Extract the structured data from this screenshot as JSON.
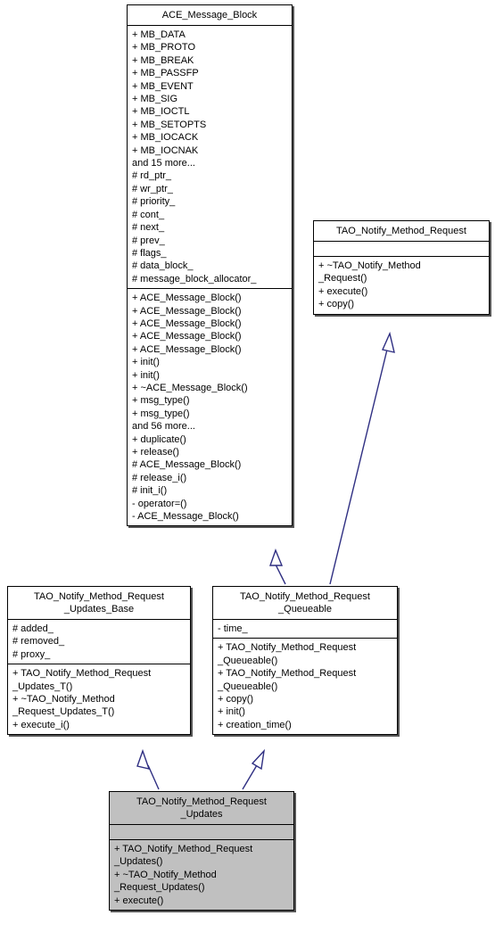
{
  "diagram": {
    "type": "uml-class-diagram",
    "background_color": "#ffffff",
    "edge_color": "#2f2f82",
    "shaded_fill": "#c0c0c0",
    "classes": [
      {
        "id": "ace_message_block",
        "name": "ACE_Message_Block",
        "shaded": false,
        "attributes": [
          "+ MB_DATA",
          "+ MB_PROTO",
          "+ MB_BREAK",
          "+ MB_PASSFP",
          "+ MB_EVENT",
          "+ MB_SIG",
          "+ MB_IOCTL",
          "+ MB_SETOPTS",
          "+ MB_IOCACK",
          "+ MB_IOCNAK",
          "and 15 more...",
          "# rd_ptr_",
          "# wr_ptr_",
          "# priority_",
          "# cont_",
          "# next_",
          "# prev_",
          "# flags_",
          "# data_block_",
          "# message_block_allocator_"
        ],
        "operations": [
          "+ ACE_Message_Block()",
          "+ ACE_Message_Block()",
          "+ ACE_Message_Block()",
          "+ ACE_Message_Block()",
          "+ ACE_Message_Block()",
          "+ init()",
          "+ init()",
          "+ ~ACE_Message_Block()",
          "+ msg_type()",
          "+ msg_type()",
          "and 56 more...",
          "+ duplicate()",
          "+ release()",
          "# ACE_Message_Block()",
          "# release_i()",
          "# init_i()",
          "- operator=()",
          "- ACE_Message_Block()"
        ]
      },
      {
        "id": "tao_notify_method_request",
        "name": "TAO_Notify_Method_Request",
        "shaded": false,
        "attributes": [],
        "operations": [
          "+ ~TAO_Notify_Method\n_Request()",
          "+ execute()",
          "+ copy()"
        ]
      },
      {
        "id": "tao_notify_method_request_updates_base",
        "name": "TAO_Notify_Method_Request\n_Updates_Base",
        "shaded": false,
        "attributes": [
          "# added_",
          "# removed_",
          "# proxy_"
        ],
        "operations": [
          "+ TAO_Notify_Method_Request\n_Updates_T()",
          "+ ~TAO_Notify_Method\n_Request_Updates_T()",
          "+ execute_i()"
        ]
      },
      {
        "id": "tao_notify_method_request_queueable",
        "name": "TAO_Notify_Method_Request\n_Queueable",
        "shaded": false,
        "attributes": [
          "- time_"
        ],
        "operations": [
          "+ TAO_Notify_Method_Request\n_Queueable()",
          "+ TAO_Notify_Method_Request\n_Queueable()",
          "+ copy()",
          "+ init()",
          "+ creation_time()"
        ]
      },
      {
        "id": "tao_notify_method_request_updates",
        "name": "TAO_Notify_Method_Request\n_Updates",
        "shaded": true,
        "attributes": [],
        "operations": [
          "+ TAO_Notify_Method_Request\n_Updates()",
          "+ ~TAO_Notify_Method\n_Request_Updates()",
          "+ execute()"
        ]
      }
    ],
    "relations": [
      {
        "kind": "inheritance",
        "from": "tao_notify_method_request_queueable",
        "to": "ace_message_block"
      },
      {
        "kind": "inheritance",
        "from": "tao_notify_method_request_queueable",
        "to": "tao_notify_method_request"
      },
      {
        "kind": "inheritance",
        "from": "tao_notify_method_request_updates",
        "to": "tao_notify_method_request_updates_base"
      },
      {
        "kind": "inheritance",
        "from": "tao_notify_method_request_updates",
        "to": "tao_notify_method_request_queueable"
      }
    ]
  }
}
